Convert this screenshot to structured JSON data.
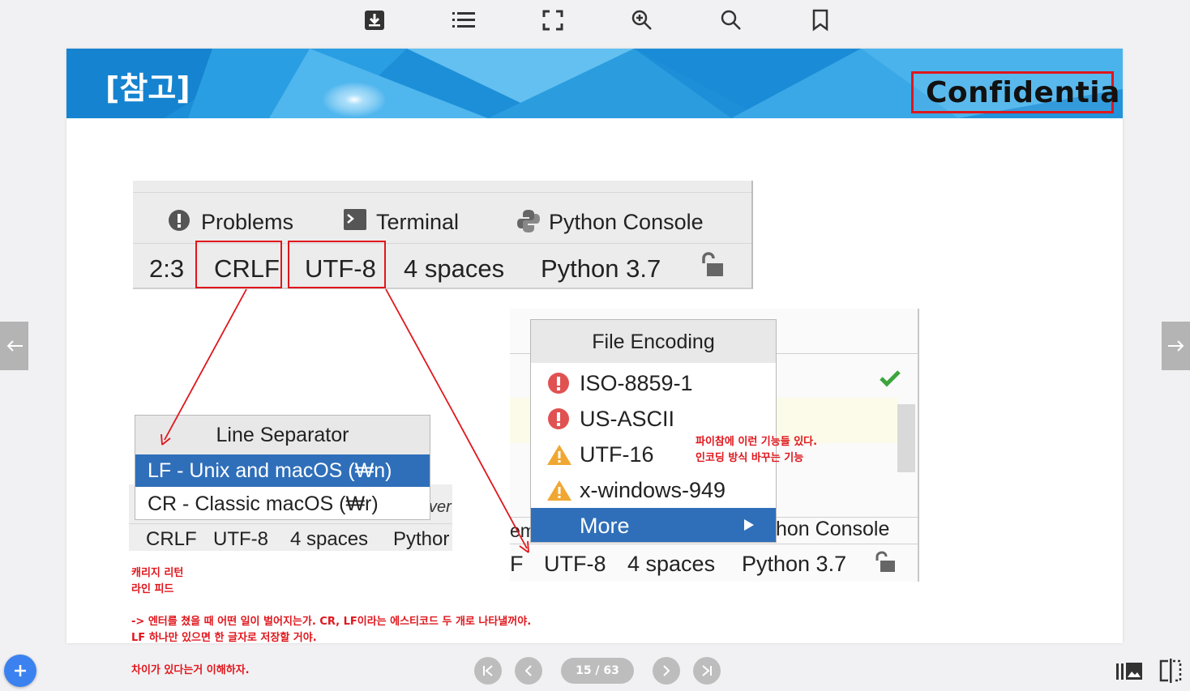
{
  "toolbar": {
    "icons": [
      "download-icon",
      "list-icon",
      "fullscreen-icon",
      "zoom-in-icon",
      "search-icon",
      "bookmark-icon"
    ]
  },
  "slide": {
    "title": "[참고]",
    "confidential": "Confidential",
    "ide_top": {
      "tabs": [
        "Problems",
        "Terminal",
        "Python Console"
      ],
      "status": [
        "2:3",
        "CRLF",
        "UTF-8",
        "4 spaces",
        "Python 3.7"
      ]
    },
    "line_separator": {
      "title": "Line Separator",
      "options": [
        "LF - Unix and macOS (₩n)",
        "CR - Classic macOS (₩r)"
      ],
      "selected_index": 0,
      "partial_text": "ver",
      "status": [
        "CRLF",
        "UTF-8",
        "4 spaces",
        "Pythor"
      ]
    },
    "file_encoding": {
      "title": "File Encoding",
      "options": [
        "ISO-8859-1",
        "US-ASCII",
        "UTF-16",
        "x-windows-949"
      ],
      "more": "More",
      "partial_left": "em",
      "partial_console": "hon Console",
      "status": [
        "F",
        "UTF-8",
        "4 spaces",
        "Python 3.7"
      ]
    },
    "annotations": {
      "right_line1": "파이참에 이런 기능들 있다.",
      "right_line2": "인코딩 방식 바꾸는 기능",
      "cr_line": "캐리지 리턴",
      "lf_line": "라인 피드",
      "explain_line1": "-> 엔터를 쳤을 때 어떤 일이 벌어지는가. CR, LF이라는 에스티코드 두 개로 나타낼꺼야.",
      "explain_line2": "LF 하나만 있으면 한 글자로 저장할 거야.",
      "explain_line3": "차이가 있다는거 이해하자."
    },
    "colors": {
      "accent": "#e0161c",
      "selection": "#2f6fba",
      "banner": "#1f8fd6"
    }
  },
  "pagination": {
    "indicator": "15 / 63"
  }
}
